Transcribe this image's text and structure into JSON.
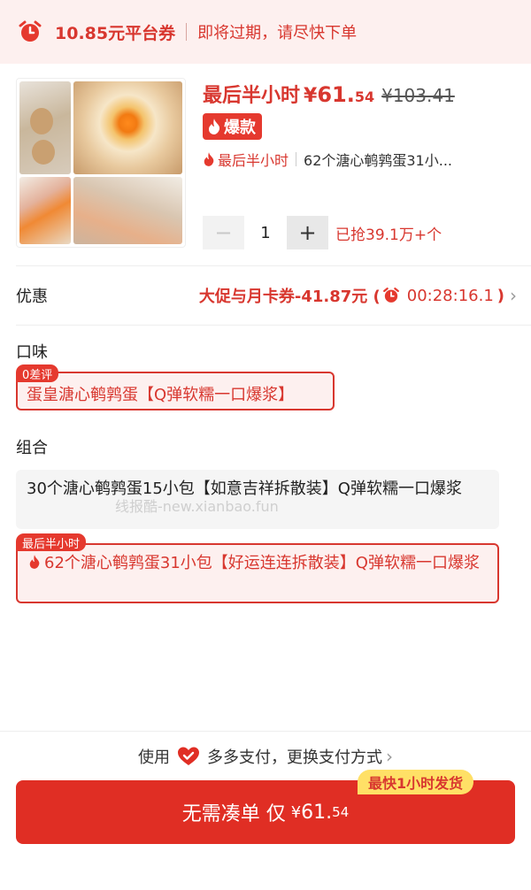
{
  "coupon_bar": {
    "amount": "10.85元平台券",
    "tip": "即将过期，请尽快下单"
  },
  "product": {
    "flash_label": "最后半小时",
    "yen": "¥",
    "price_int": "61.",
    "price_dec": "54",
    "original_price": "¥103.41",
    "hot_badge": "爆款",
    "subtitle_red": "最后半小时",
    "subtitle_name": "62个溏心鹌鹑蛋31小...",
    "quantity": "1",
    "minus": "−",
    "plus": "+",
    "sold": "已抢39.1万+个"
  },
  "promo": {
    "label": "优惠",
    "text": "大促与月卡券-41.87元 (",
    "timer": "00:28:16.1",
    "close_paren": ")"
  },
  "flavor": {
    "label": "口味",
    "option": {
      "tag": "0差评",
      "text": "蛋皇溏心鹌鹑蛋【Q弹软糯一口爆浆】"
    }
  },
  "combo": {
    "label": "组合",
    "options": [
      {
        "text": "30个溏心鹌鹑蛋15小包【如意吉祥拆散装】Q弹软糯一口爆浆"
      },
      {
        "tag": "最后半小时",
        "text": "62个溏心鹌鹑蛋31小包【好运连连拆散装】Q弹软糯一口爆浆"
      }
    ]
  },
  "watermark": "线报酷-new.xianbao.fun",
  "payment": {
    "prefix": "使用",
    "method": "多多支付，",
    "change": "更换支付方式"
  },
  "cta": {
    "label": "无需凑单 仅",
    "yen": "¥",
    "price_int": "61.",
    "price_dec": "54",
    "badge": "最快1小时发货"
  },
  "colors": {
    "accent": "#e02e24",
    "accent_text": "#d8372f",
    "tint": "#fdf0ef",
    "badge_yellow": "#ffe066"
  },
  "icons": [
    "alarm-clock-icon",
    "flame-icon",
    "chevron-right-icon",
    "heart-check-icon"
  ]
}
